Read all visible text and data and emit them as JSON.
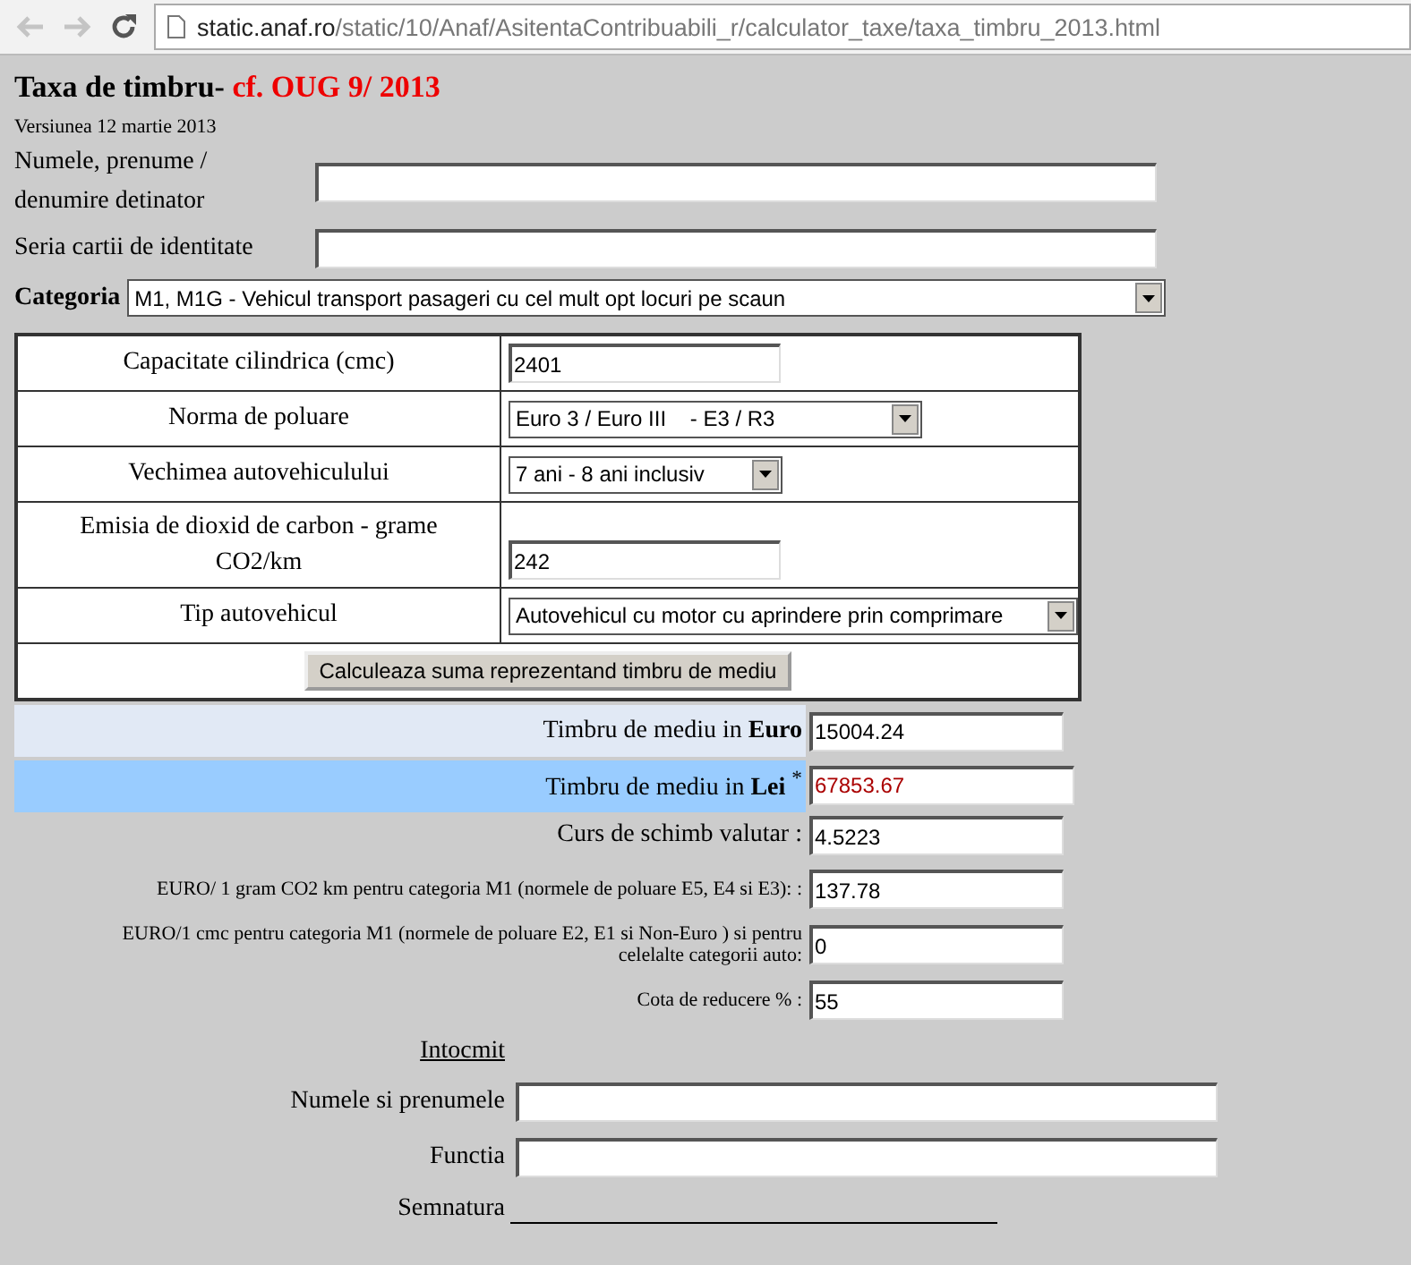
{
  "browser": {
    "url_host": "static.anaf.ro",
    "url_path": "/static/10/Anaf/AsitentaContribuabili_r/calculator_taxe/taxa_timbru_2013.html",
    "back_disabled": true,
    "forward_disabled": true
  },
  "header": {
    "title": "Taxa de timbru-",
    "title_ref": "cf. OUG 9/ 2013",
    "version": "Versiunea 12 martie 2013"
  },
  "owner_fields": [
    {
      "label": "Numele, prenume / denumire detinator"
    },
    {
      "label": "Seria cartii de identitate"
    }
  ],
  "category": {
    "label": "Categoria",
    "value": "M1, M1G - Vehicul transport pasageri cu cel mult opt locuri pe scaun"
  },
  "vehicle_rows": [
    {
      "kind": "input",
      "label": "Capacitate cilindrica (cmc)",
      "value": "2401"
    },
    {
      "kind": "select",
      "label": "Norma de poluare",
      "value": "Euro 3 / Euro III    - E3 / R3"
    },
    {
      "kind": "select",
      "label": "Vechimea autovehiculului",
      "value": "7 ani - 8 ani inclusiv"
    },
    {
      "kind": "input",
      "label": "Emisia de dioxid de carbon  - grame CO2/km",
      "value": "242"
    },
    {
      "kind": "select",
      "label": "Tip autovehicul",
      "value": "Autovehicul cu motor cu aprindere prin comprimare"
    },
    {
      "kind": "button",
      "label": "Calculeaza suma reprezentand timbru de mediu"
    }
  ],
  "results": [
    {
      "kind": "euro",
      "label": "Timbru de mediu in **Euro**",
      "value": "15004.24"
    },
    {
      "kind": "lei",
      "label": "Timbru de mediu in **Lei** $^{*}$",
      "value": "67853.67"
    },
    {
      "kind": "plain",
      "label": "Curs de schimb valutar :",
      "value": "4.5223"
    },
    {
      "kind": "small",
      "label": "EURO/ 1 gram CO2 km pentru categoria M1 (normele de poluare E5, E4 si E3): :",
      "value": "137.78"
    },
    {
      "kind": "small",
      "label": "EURO/1 cmc pentru categoria M1 (normele de poluare E2, E1 si Non-Euro ) si pentru celelalte categorii auto:",
      "value": "0"
    },
    {
      "kind": "small",
      "label": "Cota de reducere % :",
      "value": "55"
    }
  ],
  "prepared": {
    "heading": "Intocmit",
    "fields": [
      {
        "kind": "input",
        "label": "Numele si prenumele"
      },
      {
        "kind": "input",
        "label": "Functia"
      },
      {
        "kind": "signature",
        "label": "Semnatura"
      }
    ]
  }
}
